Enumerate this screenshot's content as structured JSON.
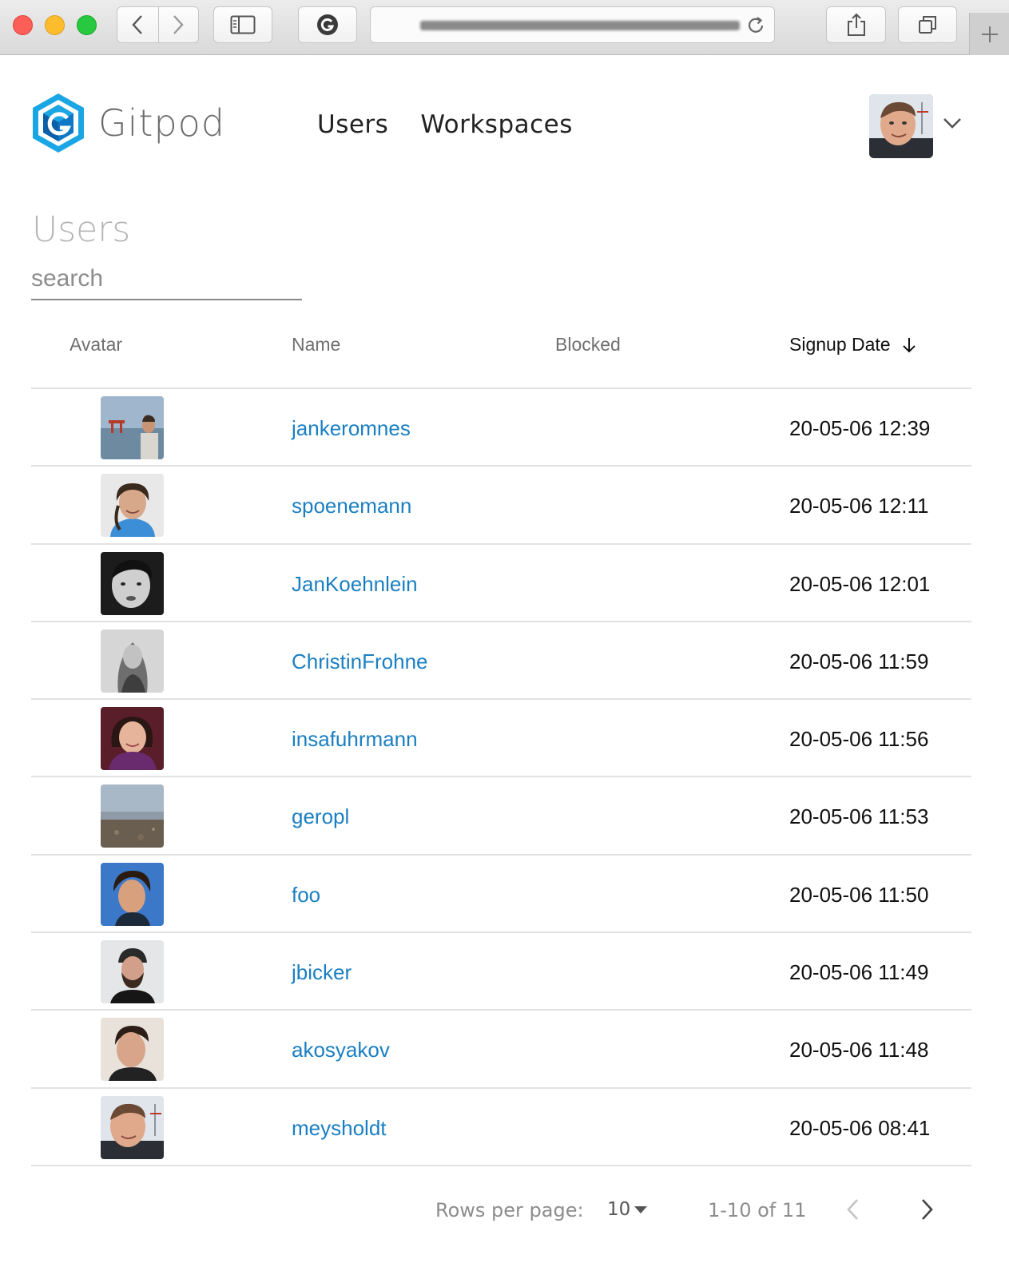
{
  "header": {
    "brand": "Gitpod",
    "nav": [
      "Users",
      "Workspaces"
    ]
  },
  "page": {
    "title": "Users",
    "search_placeholder": "search"
  },
  "table": {
    "columns": {
      "avatar": "Avatar",
      "name": "Name",
      "blocked": "Blocked",
      "signup_date": "Signup Date"
    },
    "sort": {
      "column": "Signup Date",
      "direction": "descending"
    },
    "rows": [
      {
        "name": "jankeromnes",
        "blocked": "",
        "signup_date": "20-05-06 12:39"
      },
      {
        "name": "spoenemann",
        "blocked": "",
        "signup_date": "20-05-06 12:11"
      },
      {
        "name": "JanKoehnlein",
        "blocked": "",
        "signup_date": "20-05-06 12:01"
      },
      {
        "name": "ChristinFrohne",
        "blocked": "",
        "signup_date": "20-05-06 11:59"
      },
      {
        "name": "insafuhrmann",
        "blocked": "",
        "signup_date": "20-05-06 11:56"
      },
      {
        "name": "geropl",
        "blocked": "",
        "signup_date": "20-05-06 11:53"
      },
      {
        "name": "foo",
        "blocked": "",
        "signup_date": "20-05-06 11:50"
      },
      {
        "name": "jbicker",
        "blocked": "",
        "signup_date": "20-05-06 11:49"
      },
      {
        "name": "akosyakov",
        "blocked": "",
        "signup_date": "20-05-06 11:48"
      },
      {
        "name": "meysholdt",
        "blocked": "",
        "signup_date": "20-05-06 08:41"
      }
    ]
  },
  "pagination": {
    "rows_per_page_label": "Rows per page:",
    "rows_per_page": "10",
    "range": "1-10 of 11"
  },
  "colors": {
    "link": "#1a7fc2",
    "brand_blue": "#1aa6e4",
    "brand_dark": "#0b5ea8"
  },
  "icons": {
    "logo": "gitpod-logo",
    "sort": "arrow-down-icon",
    "user_menu": "chevron-down-icon",
    "prev_page": "chevron-left-icon",
    "next_page": "chevron-right-icon",
    "rows_dropdown": "caret-down-icon"
  }
}
